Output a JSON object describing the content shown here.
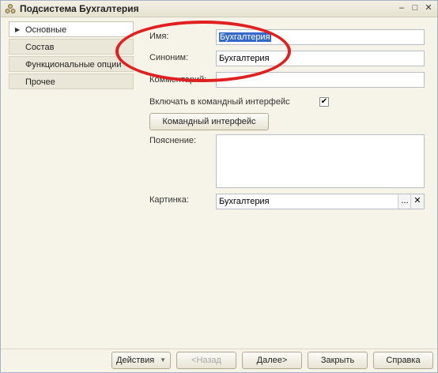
{
  "window": {
    "title": "Подсистема Бухгалтерия",
    "controls": {
      "minimize": "–",
      "maximize": "□",
      "close": "✕"
    }
  },
  "sidebar": {
    "items": [
      {
        "label": "Основные",
        "active": true
      },
      {
        "label": "Состав",
        "active": false
      },
      {
        "label": "Функциональные опции",
        "active": false
      },
      {
        "label": "Прочее",
        "active": false
      }
    ]
  },
  "form": {
    "name_label": "Имя:",
    "name_value": "Бухгалтерия",
    "synonym_label": "Синоним:",
    "synonym_value": "Бухгалтерия",
    "comment_label": "Комментарий:",
    "comment_value": "",
    "include_label": "Включать в командный интерфейс",
    "include_checked": true,
    "command_interface_button": "Командный интерфейс",
    "explanation_label": "Пояснение:",
    "explanation_value": "",
    "picture_label": "Картинка:",
    "picture_value": "Бухгалтерия",
    "picture_choose": "...",
    "picture_clear": "✕"
  },
  "footer": {
    "actions": "Действия",
    "back": "<Назад",
    "next": "Далее>",
    "close": "Закрыть",
    "help": "Справка"
  },
  "colors": {
    "highlight_oval": "#e02020",
    "selection": "#3569c7"
  }
}
